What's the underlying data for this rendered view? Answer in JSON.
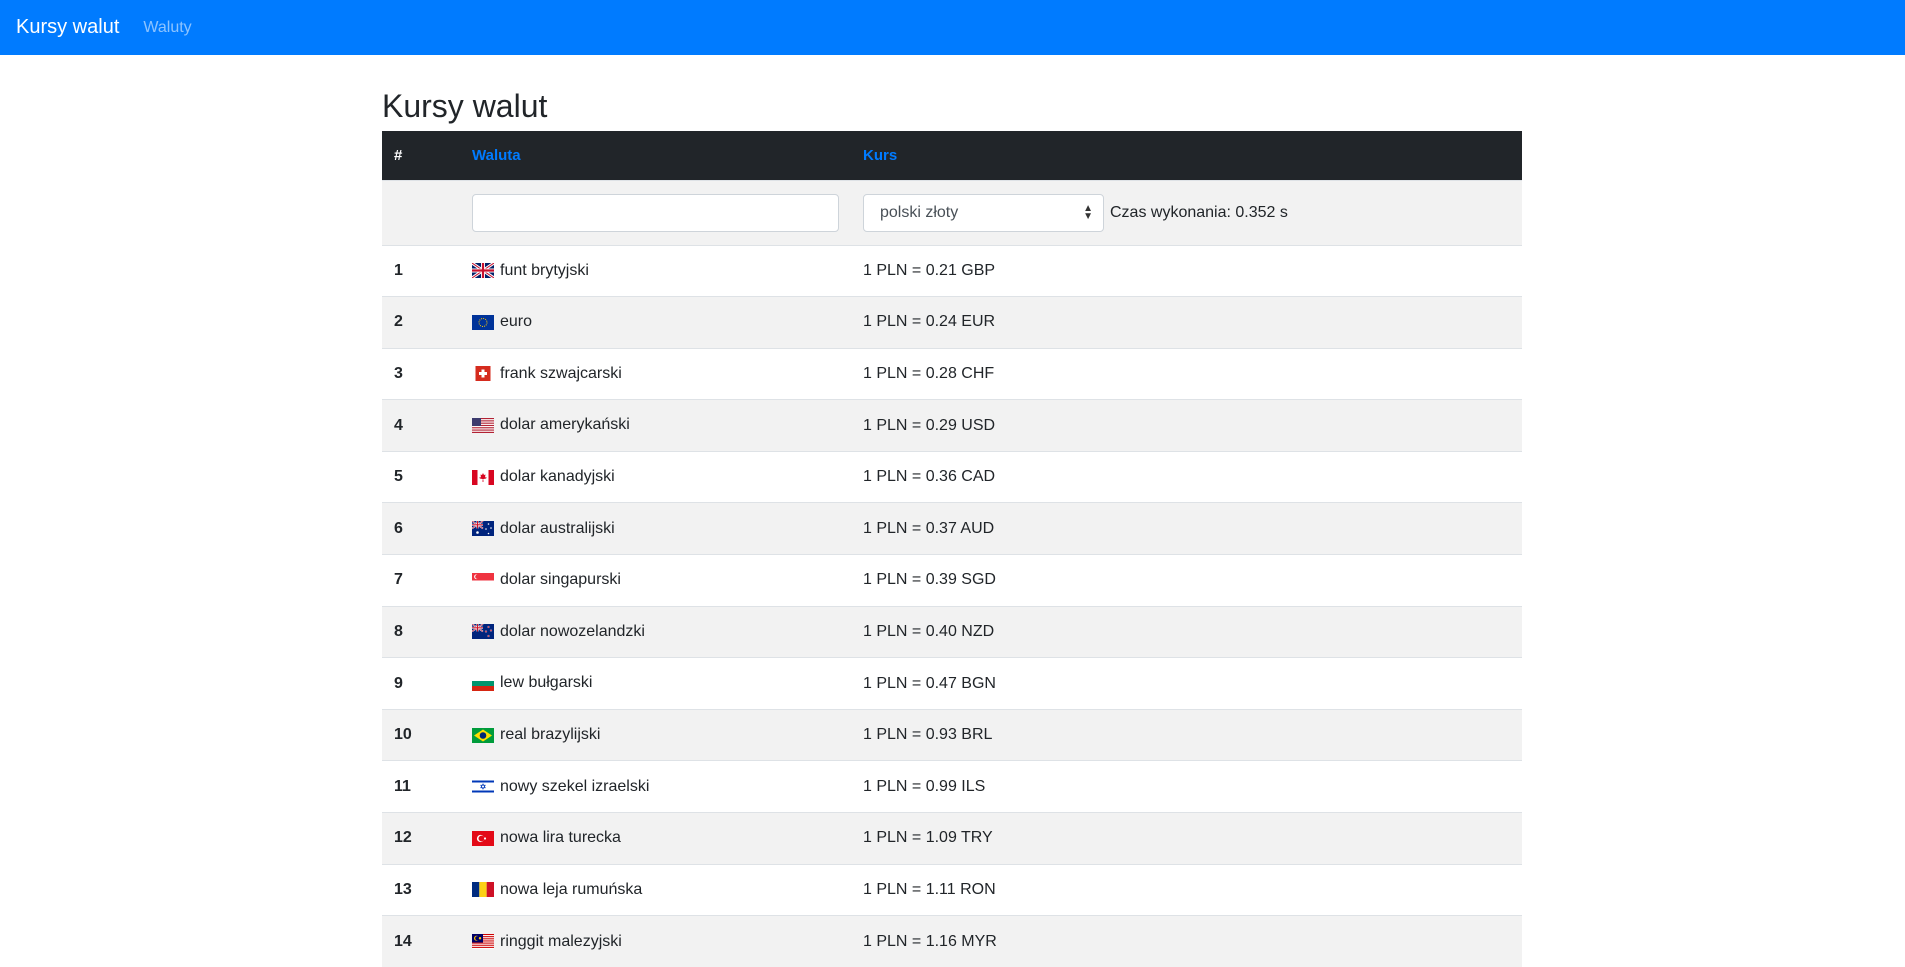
{
  "navbar": {
    "brand": "Kursy walut",
    "link": "Waluty"
  },
  "page_title": "Kursy walut",
  "table": {
    "headers": {
      "num": "#",
      "currency": "Waluta",
      "rate": "Kurs"
    },
    "filter": {
      "search_value": "",
      "select_value": "polski złoty",
      "time_label": "Czas wykonania: 0.352 s"
    },
    "rows": [
      {
        "num": "1",
        "flag": "gb-flag-icon",
        "name": "funt brytyjski",
        "rate": "1 PLN = 0.21 GBP"
      },
      {
        "num": "2",
        "flag": "eu-flag-icon",
        "name": "euro",
        "rate": "1 PLN = 0.24 EUR"
      },
      {
        "num": "3",
        "flag": "ch-flag-icon",
        "name": "frank szwajcarski",
        "rate": "1 PLN = 0.28 CHF"
      },
      {
        "num": "4",
        "flag": "us-flag-icon",
        "name": "dolar amerykański",
        "rate": "1 PLN = 0.29 USD"
      },
      {
        "num": "5",
        "flag": "ca-flag-icon",
        "name": "dolar kanadyjski",
        "rate": "1 PLN = 0.36 CAD"
      },
      {
        "num": "6",
        "flag": "au-flag-icon",
        "name": "dolar australijski",
        "rate": "1 PLN = 0.37 AUD"
      },
      {
        "num": "7",
        "flag": "sg-flag-icon",
        "name": "dolar singapurski",
        "rate": "1 PLN = 0.39 SGD"
      },
      {
        "num": "8",
        "flag": "nz-flag-icon",
        "name": "dolar nowozelandzki",
        "rate": "1 PLN = 0.40 NZD"
      },
      {
        "num": "9",
        "flag": "bg-flag-icon",
        "name": "lew bułgarski",
        "rate": "1 PLN = 0.47 BGN"
      },
      {
        "num": "10",
        "flag": "br-flag-icon",
        "name": "real brazylijski",
        "rate": "1 PLN = 0.93 BRL"
      },
      {
        "num": "11",
        "flag": "il-flag-icon",
        "name": "nowy szekel izraelski",
        "rate": "1 PLN = 0.99 ILS"
      },
      {
        "num": "12",
        "flag": "tr-flag-icon",
        "name": "nowa lira turecka",
        "rate": "1 PLN = 1.09 TRY"
      },
      {
        "num": "13",
        "flag": "ro-flag-icon",
        "name": "nowa leja rumuńska",
        "rate": "1 PLN = 1.11 RON"
      },
      {
        "num": "14",
        "flag": "my-flag-icon",
        "name": "ringgit malezyjski",
        "rate": "1 PLN = 1.16 MYR"
      }
    ]
  }
}
